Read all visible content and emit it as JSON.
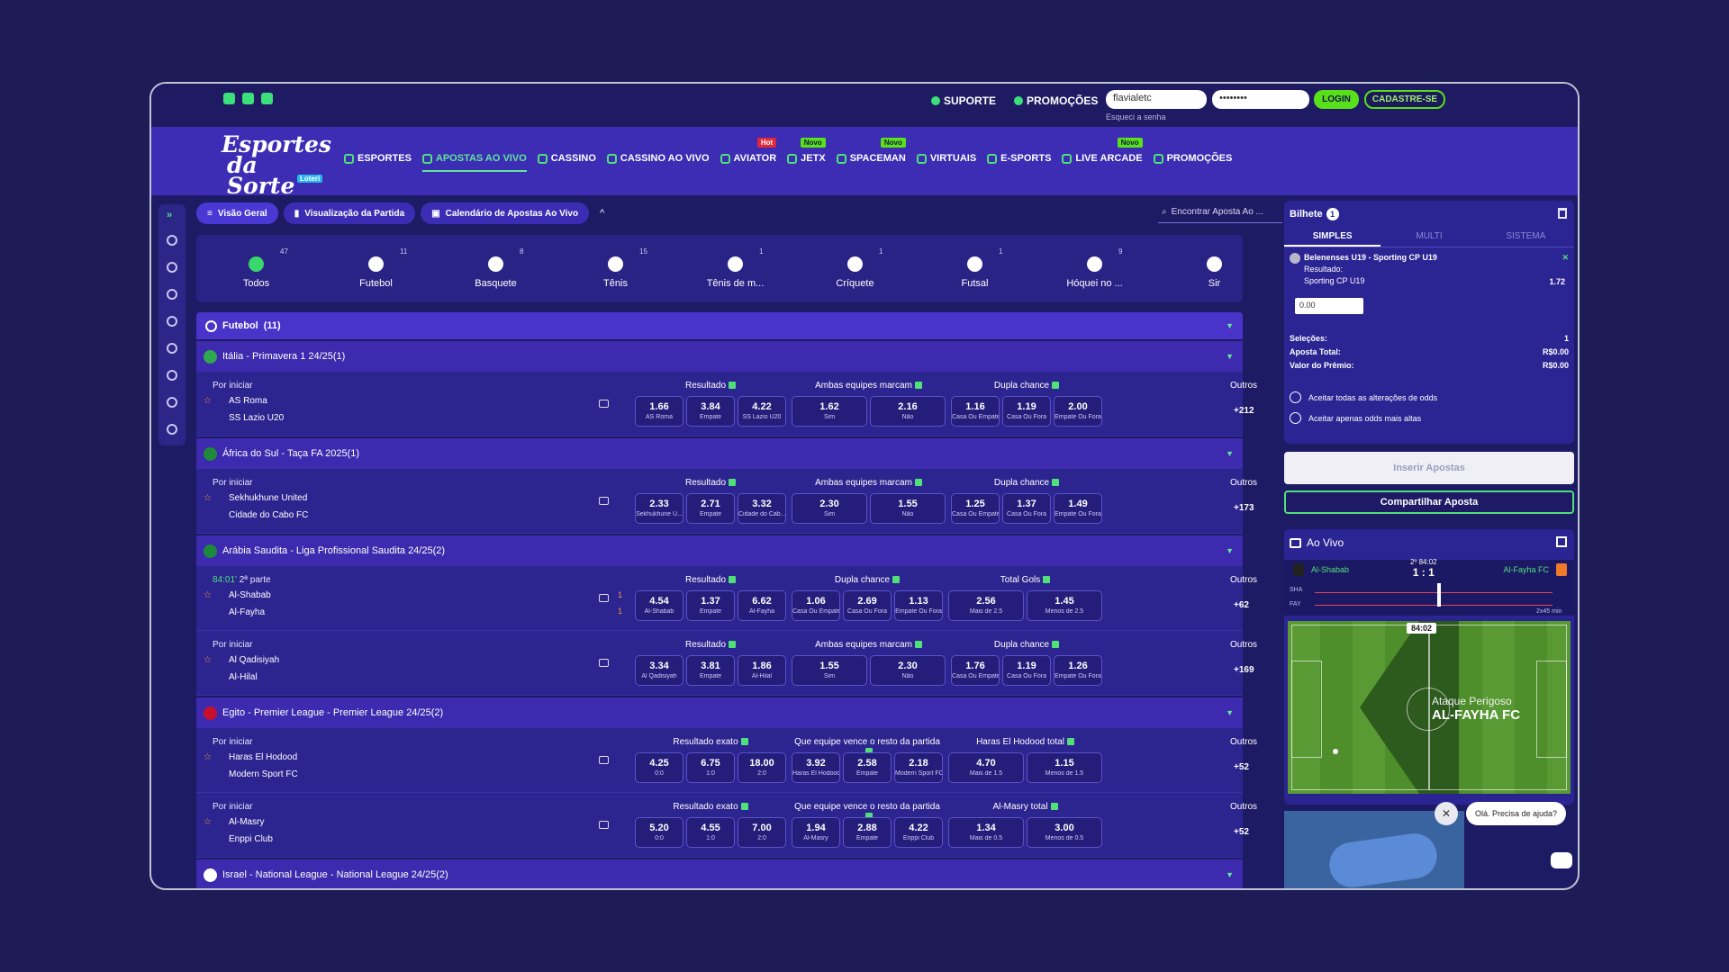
{
  "topbar": {
    "suporte": "SUPORTE",
    "promocoes": "PROMOÇÕES",
    "username": "flavialetc",
    "password": "••••••••",
    "forgot": "Esqueci a senha",
    "login": "LOGIN",
    "cadastre": "CADASTRE-SE"
  },
  "logo": {
    "line1": "Esportes",
    "line2": "da Sorte",
    "tag": "Loteri"
  },
  "nav": [
    {
      "label": "ESPORTES",
      "badge": ""
    },
    {
      "label": "APOSTAS AO VIVO",
      "badge": "",
      "active": true
    },
    {
      "label": "CASSINO",
      "badge": ""
    },
    {
      "label": "CASSINO AO VIVO",
      "badge": ""
    },
    {
      "label": "AVIATOR",
      "badge": "Hot"
    },
    {
      "label": "JETX",
      "badge": "Novo"
    },
    {
      "label": "SPACEMAN",
      "badge": "Novo"
    },
    {
      "label": "VIRTUAIS",
      "badge": ""
    },
    {
      "label": "E-SPORTS",
      "badge": ""
    },
    {
      "label": "LIVE ARCADE",
      "badge": "Novo"
    },
    {
      "label": "PROMOÇÕES",
      "badge": ""
    }
  ],
  "subtabs": {
    "visao": "Visão Geral",
    "visualizacao": "Visualização da Partida",
    "calendario": "Calendário de Apostas Ao Vivo",
    "search": "Encontrar Aposta Ao ..."
  },
  "sports": [
    {
      "name": "Todos",
      "count": "47"
    },
    {
      "name": "Futebol",
      "count": "11"
    },
    {
      "name": "Basquete",
      "count": "8"
    },
    {
      "name": "Tênis",
      "count": "15"
    },
    {
      "name": "Tênis de m...",
      "count": "1"
    },
    {
      "name": "Críquete",
      "count": "1"
    },
    {
      "name": "Futsal",
      "count": "1"
    },
    {
      "name": "Hóquei no ...",
      "count": "9"
    },
    {
      "name": "Sir",
      "count": ""
    }
  ],
  "section": {
    "name": "Futebol",
    "count": "(11)"
  },
  "leagues": [
    {
      "name": "Itália - Primavera 1 24/25(1)",
      "flag": "#2fa84f",
      "matches": [
        {
          "status": "Por iniciar",
          "live": "",
          "t1": "AS Roma",
          "t2": "SS Lazio U20",
          "s1": "",
          "s2": "",
          "groups": [
            {
              "title": "Resultado",
              "odds": [
                [
                  "1.66",
                  "AS Roma"
                ],
                [
                  "3.84",
                  "Empate"
                ],
                [
                  "4.22",
                  "SS Lazio U20"
                ]
              ]
            },
            {
              "title": "Ambas equipes marcam",
              "odds": [
                [
                  "1.62",
                  "Sim"
                ],
                [
                  "2.16",
                  "Não"
                ]
              ]
            },
            {
              "title": "Dupla chance",
              "odds": [
                [
                  "1.16",
                  "Casa Ou Empate"
                ],
                [
                  "1.19",
                  "Casa Ou Fora"
                ],
                [
                  "2.00",
                  "Empate Ou Fora"
                ]
              ]
            }
          ],
          "outros": "+212"
        }
      ]
    },
    {
      "name": "África do Sul - Taça FA 2025(1)",
      "flag": "#1f8a3a",
      "matches": [
        {
          "status": "Por iniciar",
          "live": "",
          "t1": "Sekhukhune United",
          "t2": "Cidade do Cabo FC",
          "s1": "",
          "s2": "",
          "groups": [
            {
              "title": "Resultado",
              "odds": [
                [
                  "2.33",
                  "Sekhukhune U..."
                ],
                [
                  "2.71",
                  "Empate"
                ],
                [
                  "3.32",
                  "Cidade do Cab..."
                ]
              ]
            },
            {
              "title": "Ambas equipes marcam",
              "odds": [
                [
                  "2.30",
                  "Sim"
                ],
                [
                  "1.55",
                  "Não"
                ]
              ]
            },
            {
              "title": "Dupla chance",
              "odds": [
                [
                  "1.25",
                  "Casa Ou Empate"
                ],
                [
                  "1.37",
                  "Casa Ou Fora"
                ],
                [
                  "1.49",
                  "Empate Ou Fora"
                ]
              ]
            }
          ],
          "outros": "+173"
        }
      ]
    },
    {
      "name": "Arábia Saudita - Liga Profissional Saudita 24/25(2)",
      "flag": "#1c8a3c",
      "matches": [
        {
          "status": "2ª parte",
          "live": "84:01'",
          "t1": "Al-Shabab",
          "t2": "Al-Fayha",
          "s1": "1",
          "s2": "1",
          "groups": [
            {
              "title": "Resultado",
              "odds": [
                [
                  "4.54",
                  "Al-Shabab"
                ],
                [
                  "1.37",
                  "Empate"
                ],
                [
                  "6.62",
                  "Al-Fayha"
                ]
              ]
            },
            {
              "title": "Dupla chance",
              "odds": [
                [
                  "1.06",
                  "Casa Ou Empate"
                ],
                [
                  "2.69",
                  "Casa Ou Fora"
                ],
                [
                  "1.13",
                  "Empate Ou Fora"
                ]
              ]
            },
            {
              "title": "Total Gols",
              "odds": [
                [
                  "2.56",
                  "Mais de 2.5"
                ],
                [
                  "1.45",
                  "Menos de 2.5"
                ]
              ]
            }
          ],
          "outros": "+62"
        },
        {
          "status": "Por iniciar",
          "live": "",
          "t1": "Al Qadisiyah",
          "t2": "Al-Hilal",
          "s1": "",
          "s2": "",
          "groups": [
            {
              "title": "Resultado",
              "odds": [
                [
                  "3.34",
                  "Al Qadisiyah"
                ],
                [
                  "3.81",
                  "Empate"
                ],
                [
                  "1.86",
                  "Al-Hilal"
                ]
              ]
            },
            {
              "title": "Ambas equipes marcam",
              "odds": [
                [
                  "1.55",
                  "Sim"
                ],
                [
                  "2.30",
                  "Não"
                ]
              ]
            },
            {
              "title": "Dupla chance",
              "odds": [
                [
                  "1.76",
                  "Casa Ou Empate"
                ],
                [
                  "1.19",
                  "Casa Ou Fora"
                ],
                [
                  "1.26",
                  "Empate Ou Fora"
                ]
              ]
            }
          ],
          "outros": "+169"
        }
      ]
    },
    {
      "name": "Egito - Premier League - Premier League 24/25(2)",
      "flag": "#c8102e",
      "matches": [
        {
          "status": "Por iniciar",
          "live": "",
          "t1": "Haras El Hodood",
          "t2": "Modern Sport FC",
          "s1": "",
          "s2": "",
          "groups": [
            {
              "title": "Resultado exato",
              "odds": [
                [
                  "4.25",
                  "0:0"
                ],
                [
                  "6.75",
                  "1:0"
                ],
                [
                  "18.00",
                  "2:0"
                ]
              ]
            },
            {
              "title": "Que equipe vence o resto da partida",
              "odds": [
                [
                  "3.92",
                  "Haras El Hodood"
                ],
                [
                  "2.58",
                  "Empate"
                ],
                [
                  "2.18",
                  "Modern Sport FC"
                ]
              ]
            },
            {
              "title": "Haras El Hodood total",
              "odds": [
                [
                  "4.70",
                  "Mais de 1.5"
                ],
                [
                  "1.15",
                  "Menos de 1.5"
                ]
              ]
            }
          ],
          "outros": "+52"
        },
        {
          "status": "Por iniciar",
          "live": "",
          "t1": "Al-Masry",
          "t2": "Enppi Club",
          "s1": "",
          "s2": "",
          "groups": [
            {
              "title": "Resultado exato",
              "odds": [
                [
                  "5.20",
                  "0:0"
                ],
                [
                  "4.55",
                  "1:0"
                ],
                [
                  "7.00",
                  "2:0"
                ]
              ]
            },
            {
              "title": "Que equipe vence o resto da partida",
              "odds": [
                [
                  "1.94",
                  "Al-Masry"
                ],
                [
                  "2.88",
                  "Empate"
                ],
                [
                  "4.22",
                  "Enppi Club"
                ]
              ]
            },
            {
              "title": "Al-Masry total",
              "odds": [
                [
                  "1.34",
                  "Mais de 0.5"
                ],
                [
                  "3.00",
                  "Menos de 0.5"
                ]
              ]
            }
          ],
          "outros": "+52"
        }
      ]
    },
    {
      "name": "Israel - National League - National League 24/25(2)",
      "flag": "#ffffff",
      "matches": []
    }
  ],
  "bilhete": {
    "title": "Bilhete",
    "count": "1",
    "tabs": [
      "SIMPLES",
      "MULTI",
      "SISTEMA"
    ],
    "selection": {
      "event": "Belenenses U19 - Sporting CP U19",
      "market": "Resultado:",
      "pick": "Sporting CP U19",
      "odd": "1.72"
    },
    "amount": "0.00",
    "rows": [
      {
        "k": "Seleções:",
        "v": "1"
      },
      {
        "k": "Aposta Total:",
        "v": "R$0.00"
      },
      {
        "k": "Valor do Prêmio:",
        "v": "R$0.00"
      }
    ],
    "chk1": "Aceitar todas as alterações de odds",
    "chk2": "Aceitar apenas odds mais altas",
    "inserir": "Inserir Apostas",
    "compartilhar": "Compartilhar Aposta"
  },
  "aovivo": {
    "title": "Ao Vivo",
    "home": "Al-Shabab",
    "away": "Al-Fayha FC",
    "period": "2º 84:02",
    "score": "1 : 1",
    "sha": "SHA",
    "fay": "FAY",
    "time": "84:02",
    "event": "Ataque Perigoso",
    "team": "AL-FAYHA FC",
    "mins": "2x45 min"
  },
  "chat": {
    "text": "Olá. Precisa de ajuda?"
  }
}
